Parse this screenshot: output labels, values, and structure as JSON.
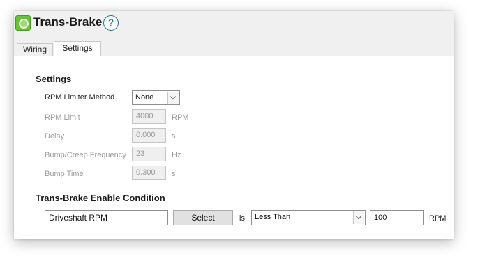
{
  "header": {
    "title": "Trans-Brake",
    "help_symbol": "?",
    "app_icon": "trans-brake-app-icon",
    "help_icon": "question-circle-icon"
  },
  "tabs": [
    {
      "label": "Wiring",
      "active": false
    },
    {
      "label": "Settings",
      "active": true
    }
  ],
  "settings": {
    "section_title": "Settings",
    "rpm_limiter_method": {
      "label": "RPM Limiter Method",
      "value": "None"
    },
    "rpm_limit": {
      "label": "RPM Limit",
      "value": "4000",
      "unit": "RPM"
    },
    "delay": {
      "label": "Delay",
      "value": "0.000",
      "unit": "s"
    },
    "bump_creep_frequency": {
      "label": "Bump/Creep Frequency",
      "value": "23",
      "unit": "Hz"
    },
    "bump_time": {
      "label": "Bump Time",
      "value": "0.300",
      "unit": "s"
    }
  },
  "enable_condition": {
    "section_title": "Trans-Brake Enable Condition",
    "channel": "Driveshaft RPM",
    "select_label": "Select",
    "is_label": "is",
    "comparison": "Less Than",
    "threshold": "100",
    "unit": "RPM"
  },
  "colors": {
    "accent_green": "#6abf3b",
    "help_blue": "#2b6f83"
  }
}
